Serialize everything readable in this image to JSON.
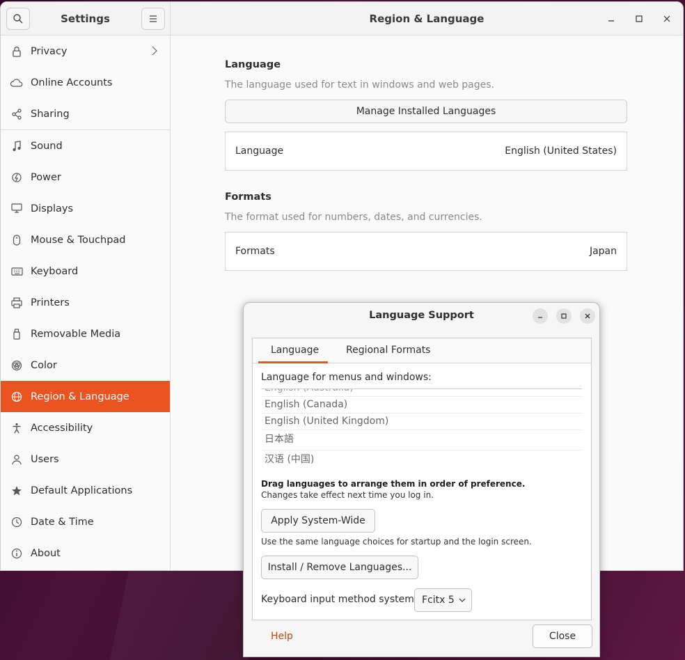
{
  "sidebar": {
    "title": "Settings",
    "items": [
      {
        "label": "Privacy",
        "icon": "lock-icon",
        "name": "sidebar-item-privacy"
      },
      {
        "label": "Online Accounts",
        "icon": "cloud-icon",
        "name": "sidebar-item-online-accounts"
      },
      {
        "label": "Sharing",
        "icon": "share-icon",
        "name": "sidebar-item-sharing"
      },
      {
        "label": "Sound",
        "icon": "music-note-icon",
        "name": "sidebar-item-sound"
      },
      {
        "label": "Power",
        "icon": "power-icon",
        "name": "sidebar-item-power"
      },
      {
        "label": "Displays",
        "icon": "display-icon",
        "name": "sidebar-item-displays"
      },
      {
        "label": "Mouse & Touchpad",
        "icon": "mouse-icon",
        "name": "sidebar-item-mouse-touchpad"
      },
      {
        "label": "Keyboard",
        "icon": "keyboard-icon",
        "name": "sidebar-item-keyboard"
      },
      {
        "label": "Printers",
        "icon": "printer-icon",
        "name": "sidebar-item-printers"
      },
      {
        "label": "Removable Media",
        "icon": "usb-icon",
        "name": "sidebar-item-removable-media"
      },
      {
        "label": "Color",
        "icon": "color-icon",
        "name": "sidebar-item-color"
      },
      {
        "label": "Region & Language",
        "icon": "globe-icon",
        "name": "sidebar-item-region-language"
      },
      {
        "label": "Accessibility",
        "icon": "accessibility-icon",
        "name": "sidebar-item-accessibility"
      },
      {
        "label": "Users",
        "icon": "user-icon",
        "name": "sidebar-item-users"
      },
      {
        "label": "Default Applications",
        "icon": "star-icon",
        "name": "sidebar-item-default-applications"
      },
      {
        "label": "Date & Time",
        "icon": "clock-icon",
        "name": "sidebar-item-date-time"
      },
      {
        "label": "About",
        "icon": "info-icon",
        "name": "sidebar-item-about"
      }
    ],
    "active": "Region & Language"
  },
  "main": {
    "title": "Region & Language",
    "language_section": {
      "title": "Language",
      "description": "The language used for text in windows and web pages.",
      "manage_button": "Manage Installed Languages",
      "row_label": "Language",
      "row_value": "English (United States)"
    },
    "formats_section": {
      "title": "Formats",
      "description": "The format used for numbers, dates, and currencies.",
      "row_label": "Formats",
      "row_value": "Japan"
    }
  },
  "dialog": {
    "title": "Language Support",
    "tabs": [
      "Language",
      "Regional Formats"
    ],
    "active_tab": "Language",
    "list_label": "Language for menus and windows:",
    "languages": [
      "English (Australia)",
      "English (Canada)",
      "English (United Kingdom)",
      "日本語",
      "汉语 (中国)"
    ],
    "drag_note": "Drag languages to arrange them in order of preference.",
    "effect_note": "Changes take effect next time you log in.",
    "apply_button": "Apply System-Wide",
    "apply_note": "Use the same language choices for startup and the login screen.",
    "install_button": "Install / Remove Languages...",
    "input_method_label": "Keyboard input method system:",
    "input_method_value": "Fcitx 5",
    "help_label": "Help",
    "close_label": "Close"
  },
  "colors": {
    "accent": "#e95420",
    "help_link": "#c7430f"
  }
}
